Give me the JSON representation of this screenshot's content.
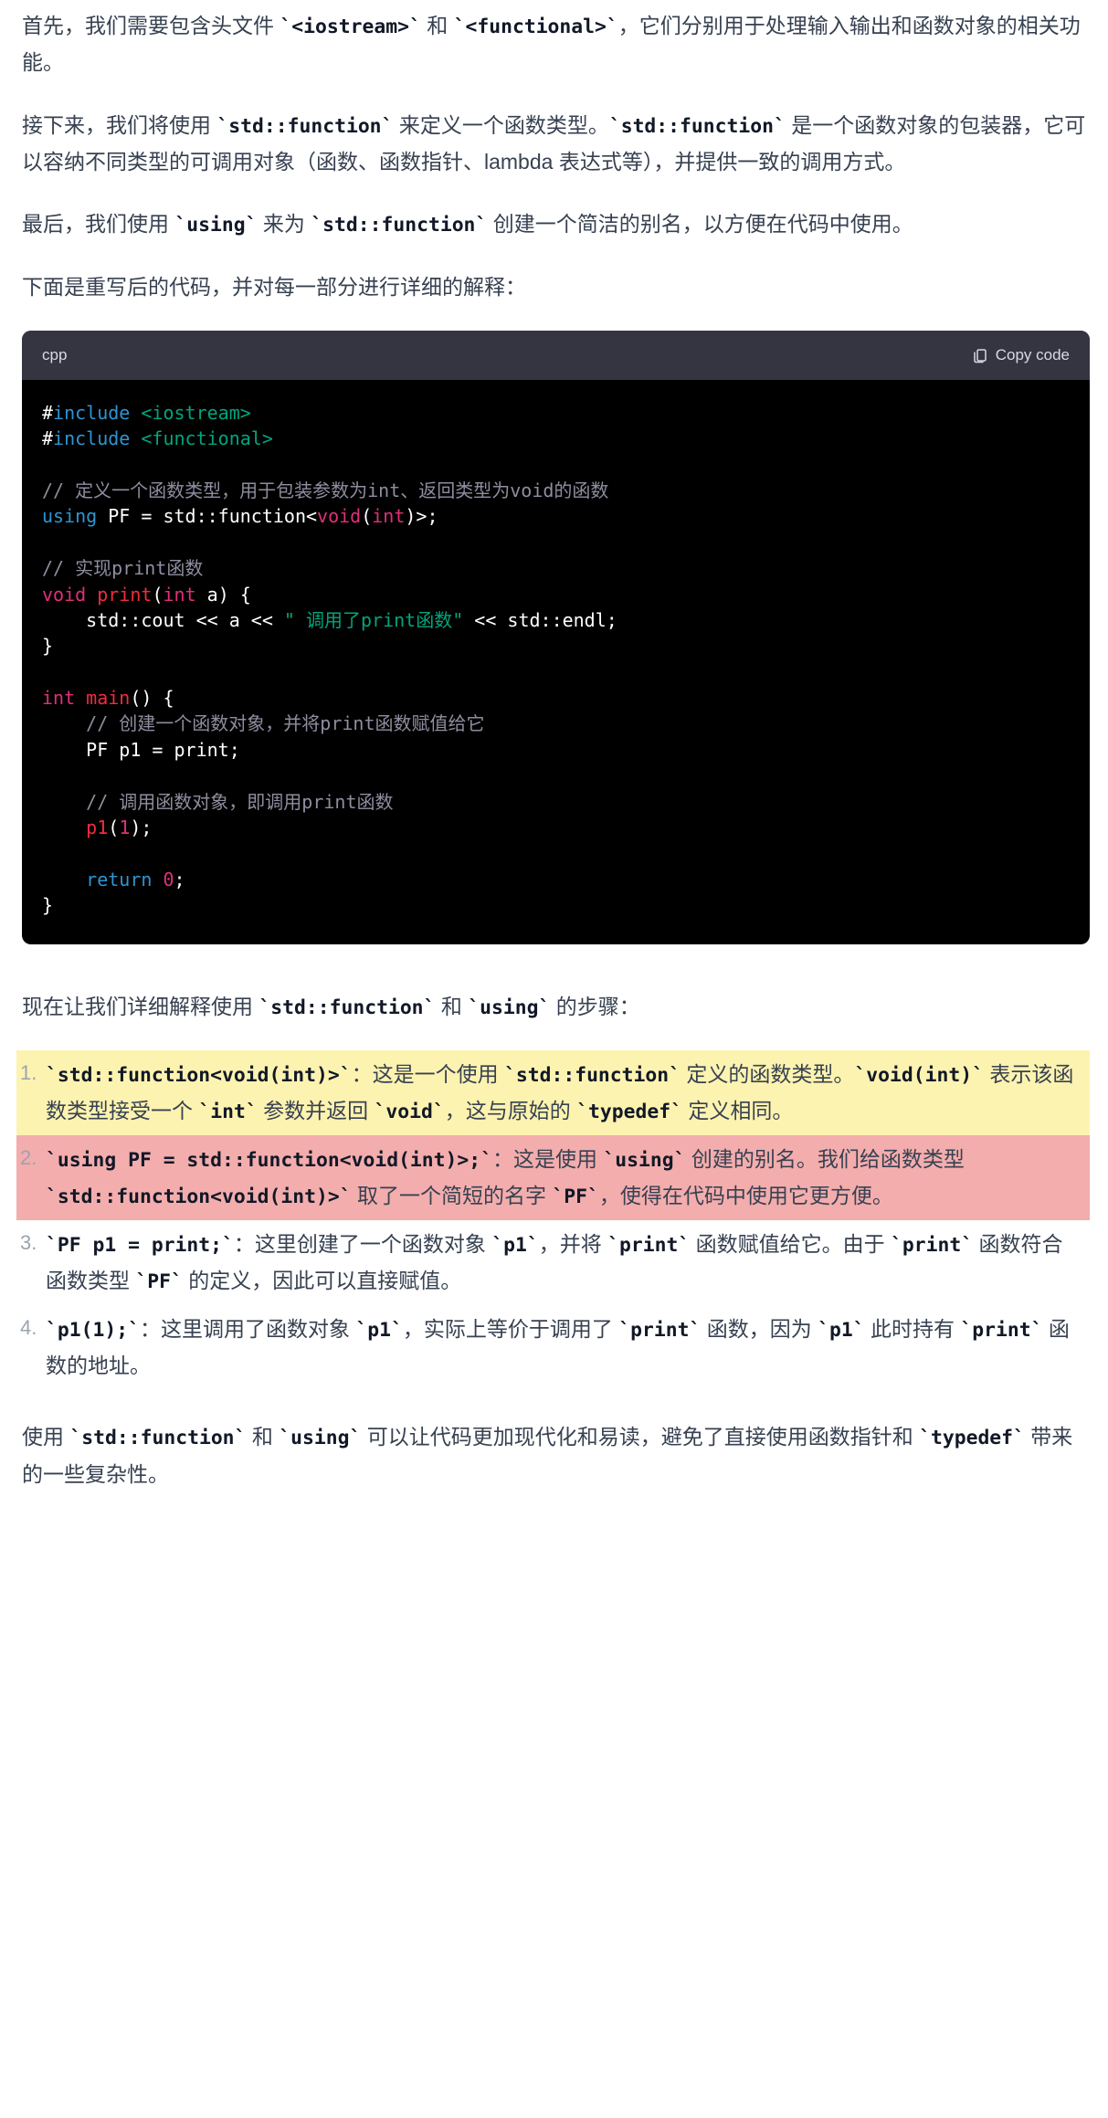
{
  "para1": {
    "t1": "首先，我们需要包含头文件 ",
    "c1": "`<iostream>`",
    "t2": " 和 ",
    "c2": "`<functional>`",
    "t3": "，它们分别用于处理输入输出和函数对象的相关功能。"
  },
  "para2": {
    "t1": "接下来，我们将使用 ",
    "c1": "`std::function`",
    "t2": " 来定义一个函数类型。",
    "c2": "`std::function`",
    "t3": " 是一个函数对象的包装器，它可以容纳不同类型的可调用对象（函数、函数指针、lambda 表达式等），并提供一致的调用方式。"
  },
  "para3": {
    "t1": "最后，我们使用 ",
    "c1": "`using`",
    "t2": " 来为 ",
    "c2": "`std::function`",
    "t3": " 创建一个简洁的别名，以方便在代码中使用。"
  },
  "para4": "下面是重写后的代码，并对每一部分进行详细的解释：",
  "codeblock": {
    "lang": "cpp",
    "copy_label": "Copy code",
    "lines": {
      "l1_macro": "#",
      "l1_inc": "include",
      "l1_hdr": " <iostream>",
      "l2_macro": "#",
      "l2_inc": "include",
      "l2_hdr": " <functional>",
      "l4_comment": "// 定义一个函数类型，用于包装参数为int、返回类型为void的函数",
      "l5_using": "using",
      "l5_pf": " PF = std::function<",
      "l5_void": "void",
      "l5_paren": "(",
      "l5_int": "int",
      "l5_end": ")>;",
      "l7_comment": "// 实现print函数",
      "l8_void": "void",
      "l8_sp": " ",
      "l8_print": "print",
      "l8_paren": "(",
      "l8_int": "int",
      "l8_rest": " a) {",
      "l9_indent": "    std::cout << a << ",
      "l9_str": "\" 调用了print函数\"",
      "l9_rest": " << std::endl;",
      "l10": "}",
      "l12_int": "int",
      "l12_sp": " ",
      "l12_main": "main",
      "l12_rest": "() {",
      "l13_comment": "    // 创建一个函数对象，并将print函数赋值给它",
      "l14": "    PF p1 = print;",
      "l16_comment": "    // 调用函数对象，即调用print函数",
      "l17_a": "    ",
      "l17_call": "p1",
      "l17_paren": "(",
      "l17_num": "1",
      "l17_end": ");",
      "l19_ret": "    return",
      "l19_sp": " ",
      "l19_zero": "0",
      "l19_semi": ";",
      "l20": "}"
    }
  },
  "para5": {
    "t1": "现在让我们详细解释使用 ",
    "c1": "`std::function`",
    "t2": " 和 ",
    "c2": "`using`",
    "t3": " 的步骤："
  },
  "steps": {
    "s1": {
      "num": "1",
      "c1": "`std::function<void(int)>`",
      "t1": "：这是一个使用 ",
      "c2": "`std::function`",
      "t2": " 定义的函数类型。",
      "c3": "`void(int)`",
      "t3": " 表示该函数类型接受一个 ",
      "c4": "`int`",
      "t4": " 参数并返回 ",
      "c5": "`void`",
      "t5": "，这与原始的 ",
      "c6": "`typedef`",
      "t6": " 定义相同。"
    },
    "s2": {
      "num": "2",
      "c1": "`using PF = std::function<void(int)>;`",
      "t1": "：这是使用 ",
      "c2": "`using`",
      "t2": " 创建的别名。我们给函数类型 ",
      "c3": "`std::function<void(int)>`",
      "t3": " 取了一个简短的名字 ",
      "c4": "`PF`",
      "t4": "，使得在代码中使用它更方便。"
    },
    "s3": {
      "num": "3",
      "c1": "`PF p1 = print;`",
      "t1": "：这里创建了一个函数对象 ",
      "c2": "`p1`",
      "t2": "，并将 ",
      "c3": "`print`",
      "t3": " 函数赋值给它。由于 ",
      "c4": "`print`",
      "t4": " 函数符合函数类型 ",
      "c5": "`PF`",
      "t5": " 的定义，因此可以直接赋值。"
    },
    "s4": {
      "num": "4",
      "c1": "`p1(1);`",
      "t1": "：这里调用了函数对象 ",
      "c2": "`p1`",
      "t2": "，实际上等价于调用了 ",
      "c3": "`print`",
      "t3": " 函数，因为 ",
      "c4": "`p1`",
      "t4": " 此时持有 ",
      "c5": "`print`",
      "t5": " 函数的地址。"
    }
  },
  "para6": {
    "t1": "使用 ",
    "c1": "`std::function`",
    "t2": " 和 ",
    "c2": "`using`",
    "t3": " 可以让代码更加现代化和易读，避免了直接使用函数指针和 ",
    "c3": "`typedef`",
    "t4": " 带来的一些复杂性。"
  }
}
